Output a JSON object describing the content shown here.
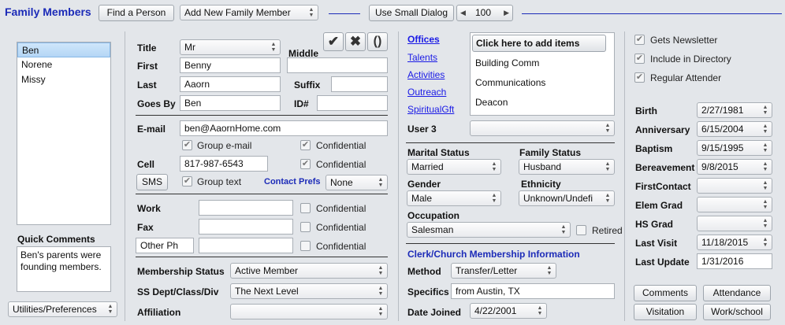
{
  "toolbar": {
    "title": "Family Members",
    "find_button": "Find a Person",
    "add_select": "Add New Family Member",
    "small_dialog_button": "Use Small Dialog",
    "zoom_value": "100"
  },
  "members": [
    "Ben",
    "Norene",
    "Missy"
  ],
  "quick_comments": {
    "label": "Quick Comments",
    "text": "Ben's parents were founding members."
  },
  "utilities_select": "Utilities/Preferences",
  "name": {
    "title_label": "Title",
    "title_value": "Mr",
    "middle_label": "Middle",
    "middle_value": "",
    "first_label": "First",
    "first_value": "Benny",
    "last_label": "Last",
    "last_value": "Aaorn",
    "suffix_label": "Suffix",
    "suffix_value": "",
    "goesby_label": "Goes By",
    "goesby_value": "Ben",
    "id_label": "ID#",
    "id_value": ""
  },
  "contact": {
    "email_label": "E-mail",
    "email_value": "ben@AaornHome.com",
    "group_email": "Group e-mail",
    "confidential": "Confidential",
    "cell_label": "Cell",
    "cell_value": "817-987-6543",
    "sms_button": "SMS",
    "group_text": "Group text",
    "contact_prefs_label": "Contact Prefs",
    "contact_prefs_value": "None",
    "work_label": "Work",
    "work_value": "",
    "fax_label": "Fax",
    "fax_value": "",
    "other_label": "Other Ph",
    "other_value": ""
  },
  "membership": {
    "status_label": "Membership Status",
    "status_value": "Active Member",
    "ss_label": "SS Dept/Class/Div",
    "ss_value": "The Next Level",
    "affiliation_label": "Affiliation",
    "affiliation_value": ""
  },
  "groups": {
    "tabs": [
      "Offices",
      "Talents",
      "Activities",
      "Outreach",
      "SpiritualGft"
    ],
    "add_header": "Click here to add items",
    "items": [
      "Building Comm",
      "Communications",
      "Deacon"
    ]
  },
  "user3": {
    "label": "User 3",
    "value": ""
  },
  "family": {
    "marital_label": "Marital Status",
    "marital_value": "Married",
    "family_status_label": "Family Status",
    "family_status_value": "Husband",
    "gender_label": "Gender",
    "gender_value": "Male",
    "ethnicity_label": "Ethnicity",
    "ethnicity_value": "Unknown/Undefi",
    "occupation_label": "Occupation",
    "occupation_value": "Salesman",
    "retired_label": "Retired"
  },
  "clerk": {
    "heading": "Clerk/Church Membership Information",
    "method_label": "Method",
    "method_value": "Transfer/Letter",
    "specifics_label": "Specifics",
    "specifics_value": "from Austin, TX",
    "joined_label": "Date Joined",
    "joined_value": "4/22/2001"
  },
  "flags": {
    "newsletter": "Gets Newsletter",
    "directory": "Include in Directory",
    "regular": "Regular Attender"
  },
  "dates": [
    {
      "label": "Birth",
      "value": "2/27/1981"
    },
    {
      "label": "Anniversary",
      "value": "6/15/2004"
    },
    {
      "label": "Baptism",
      "value": "9/15/1995"
    },
    {
      "label": "Bereavement",
      "value": "9/8/2015"
    },
    {
      "label": "FirstContact",
      "value": ""
    },
    {
      "label": "Elem Grad",
      "value": ""
    },
    {
      "label": "HS Grad",
      "value": ""
    },
    {
      "label": "Last Visit",
      "value": "11/18/2015"
    },
    {
      "label": "Last Update",
      "value": "1/31/2016"
    }
  ],
  "bottom_buttons": {
    "comments": "Comments",
    "attendance": "Attendance",
    "visitation": "Visitation",
    "workschool": "Work/school"
  },
  "colors": {
    "accent": "#1a1ae6",
    "title": "#1c2bb8",
    "selection": "#b4d6f5"
  }
}
